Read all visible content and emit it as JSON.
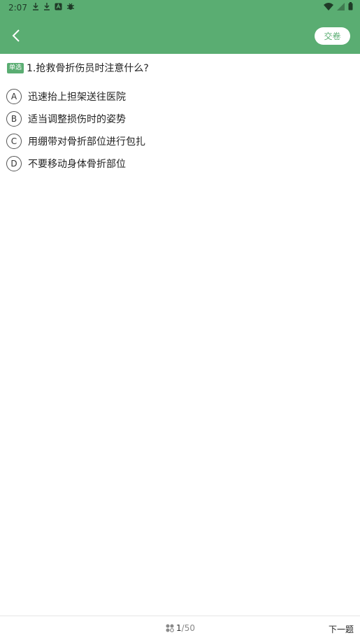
{
  "status_bar": {
    "time": "2:07",
    "icons": [
      "download-icon",
      "download-icon",
      "a-badge-icon",
      "bug-icon"
    ],
    "right_icons": [
      "wifi-icon",
      "signal-icon",
      "battery-icon"
    ]
  },
  "header": {
    "submit_label": "交卷",
    "accent_color": "#5aad72"
  },
  "question": {
    "type_label": "单选",
    "text": "1.抢救骨折伤员时注意什么?"
  },
  "options": [
    {
      "letter": "A",
      "text": "迅速抬上担架送往医院"
    },
    {
      "letter": "B",
      "text": "适当调整损伤时的姿势"
    },
    {
      "letter": "C",
      "text": "用绷带对骨折部位进行包扎"
    },
    {
      "letter": "D",
      "text": "不要移动身体骨折部位"
    }
  ],
  "footer": {
    "current": "1",
    "separator": "/",
    "total": "50",
    "next_label": "下一题"
  }
}
